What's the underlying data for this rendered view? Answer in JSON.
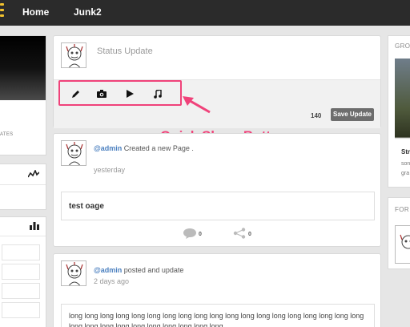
{
  "nav": {
    "items": [
      {
        "label": "Home"
      },
      {
        "label": "Junk2"
      }
    ]
  },
  "left": {
    "partial_text": "ATES"
  },
  "composer": {
    "placeholder": "Status Update",
    "share_buttons": [
      "pencil-icon",
      "camera-icon",
      "play-icon",
      "music-icon"
    ],
    "char_count": "140",
    "save_label": "Save Update"
  },
  "annotation": {
    "label": "Quick Share Buttons",
    "color": "#f0427a"
  },
  "posts": [
    {
      "user": "@admin",
      "action": "Created a new Page .",
      "time": "yesterday",
      "title": "test oage",
      "comments": "0",
      "shares": "0"
    },
    {
      "user": "@admin",
      "action": "posted and update",
      "time": "2 days ago",
      "body": "long long long long long long long long long long long long long long long long long long long long long long long long long long long long long"
    }
  ],
  "right": {
    "groups_title": "GRO",
    "group_name": "Str",
    "group_line1": "son",
    "group_line2": "gra",
    "forums_title": "FOR"
  },
  "colors": {
    "topbar": "#2b2b2b",
    "accent": "#f2c22e",
    "link": "#4a7fbf",
    "annotation": "#f0427a"
  }
}
